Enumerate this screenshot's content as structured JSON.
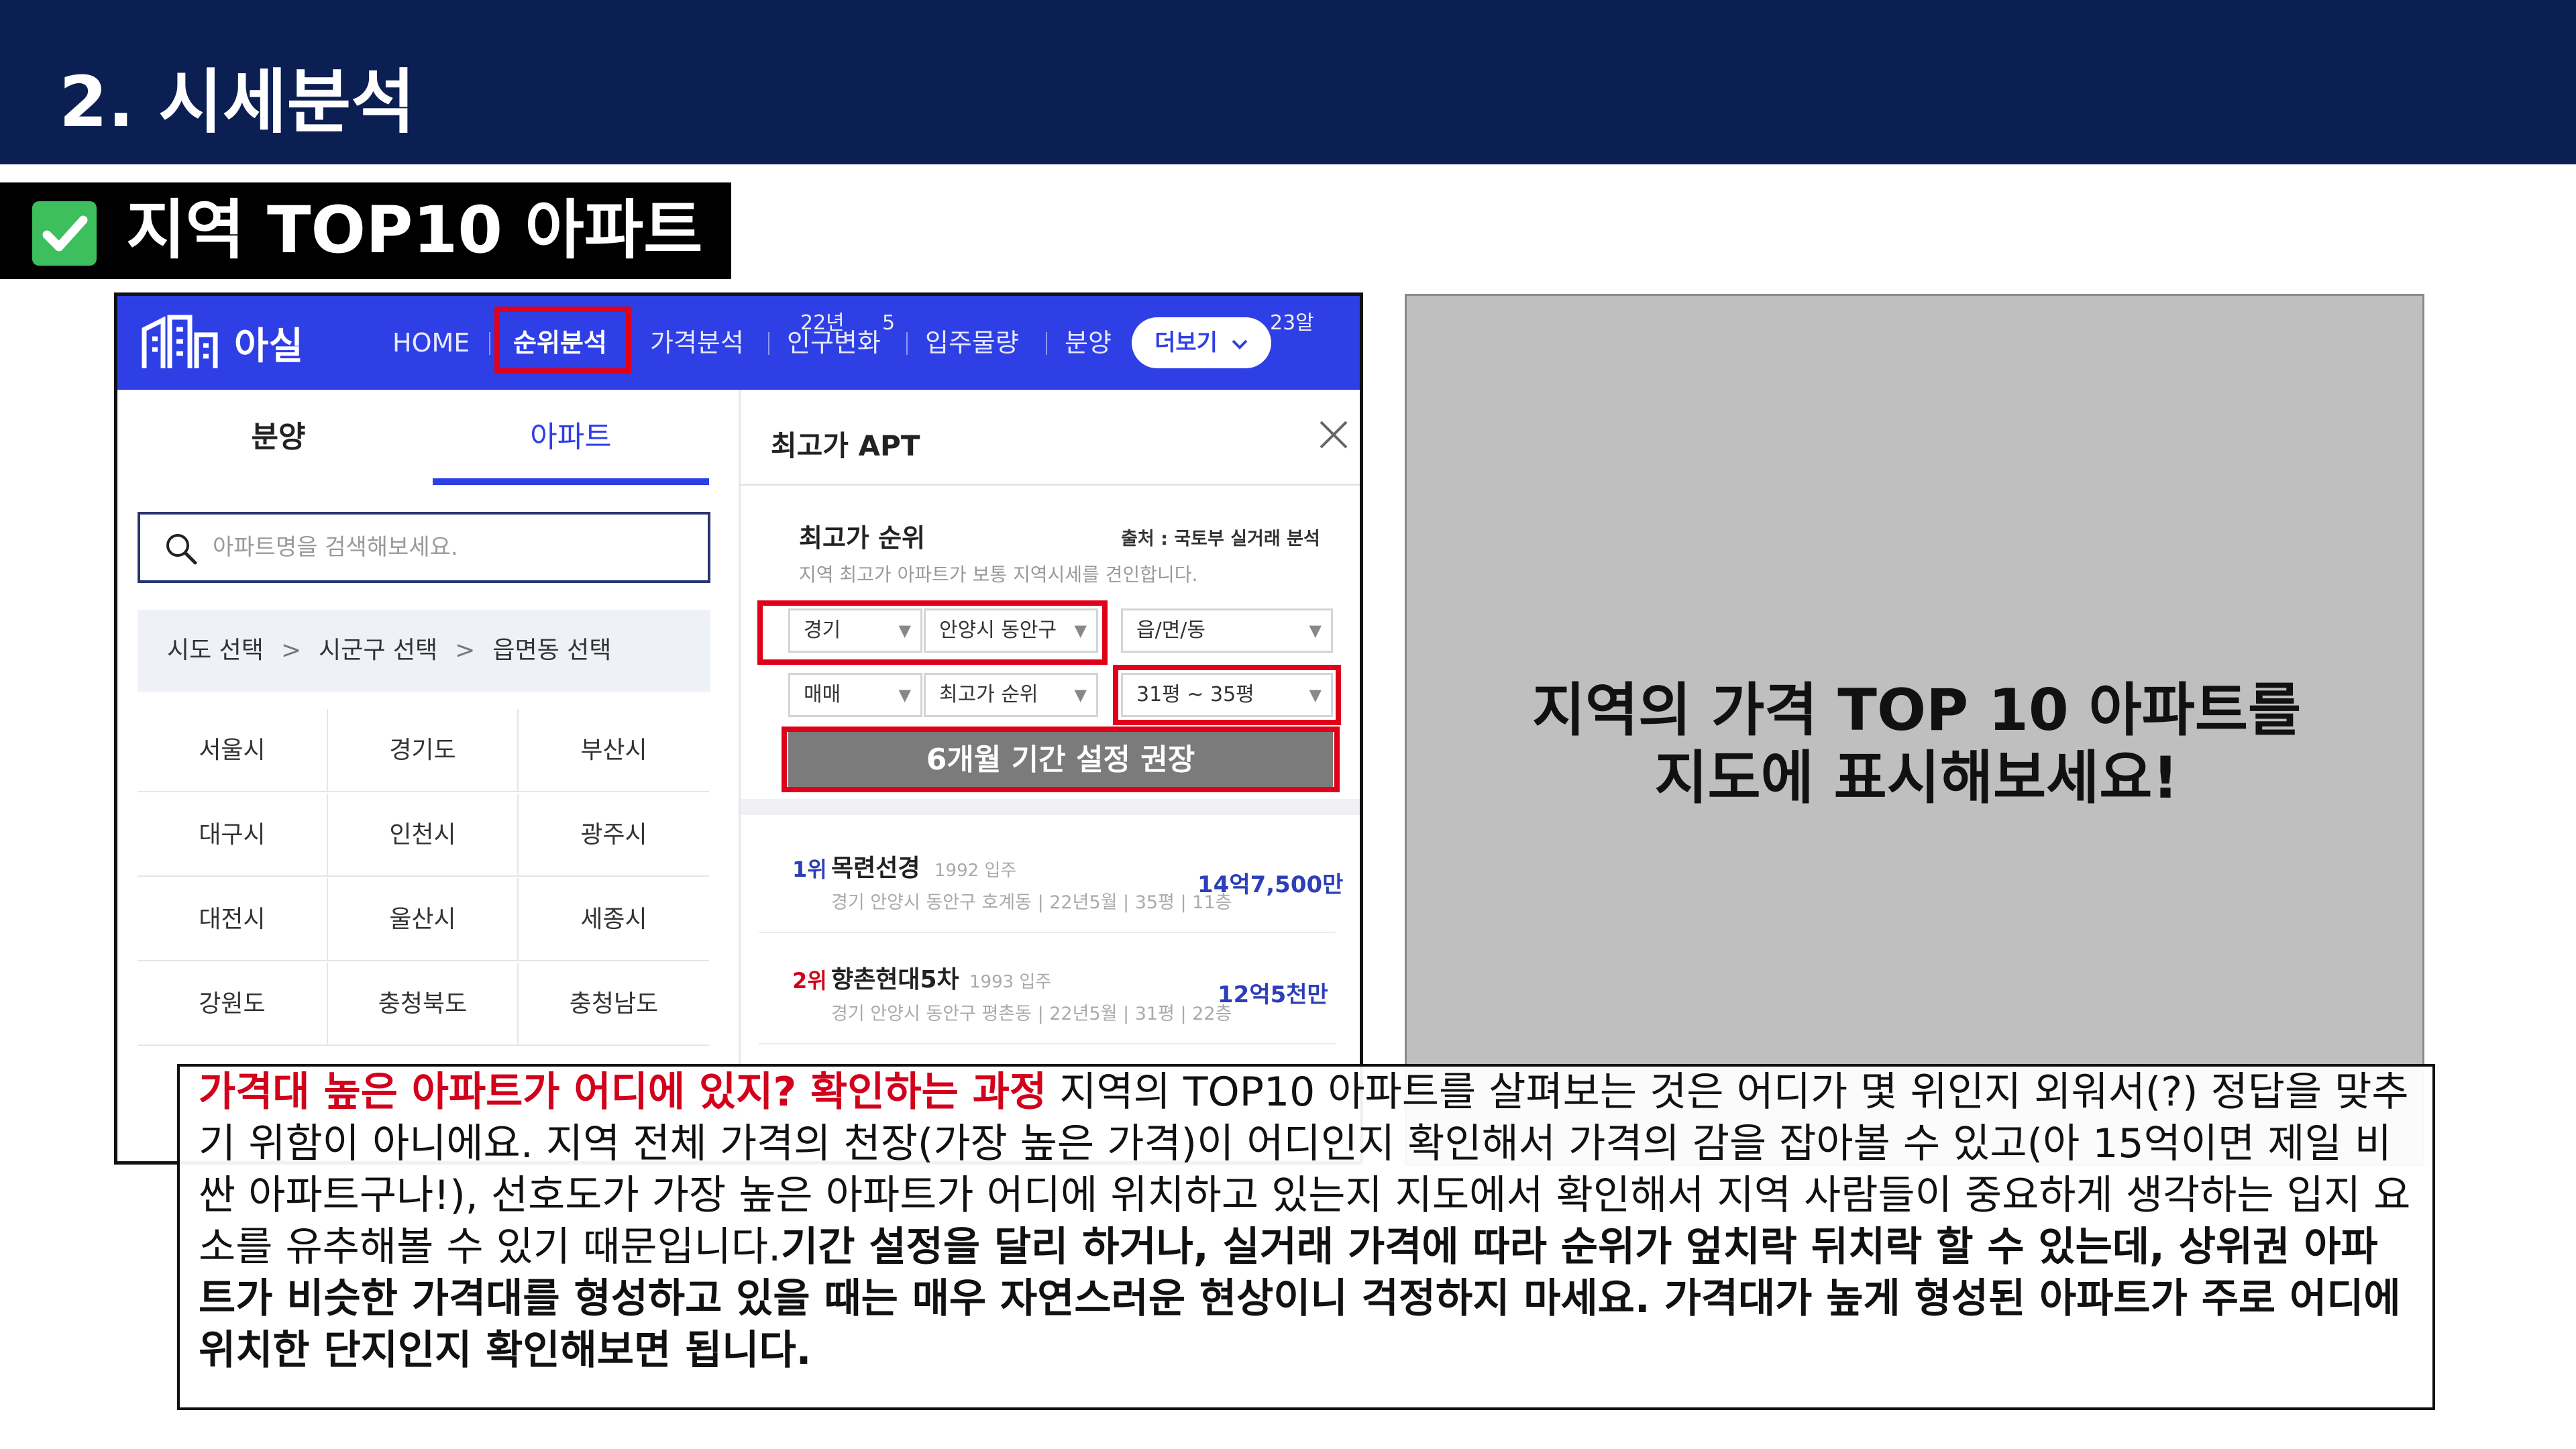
{
  "slide": {
    "title": "2. 시세분석",
    "subtitle": "지역 TOP10 아파트"
  },
  "app": {
    "logo_text": "아실",
    "nav": [
      "HOME",
      "순위분석",
      "가격분석",
      "인구변화",
      "입주물량",
      "분양"
    ],
    "more_button": "더보기",
    "tabs": [
      "분양",
      "아파트"
    ],
    "search_placeholder": "아파트명을 검색해보세요.",
    "region_path": [
      "시도 선택",
      "시군구 선택",
      "읍면동 선택"
    ],
    "regions": [
      "서울시",
      "경기도",
      "부산시",
      "대구시",
      "인천시",
      "광주시",
      "대전시",
      "울산시",
      "세종시",
      "강원도",
      "충청북도",
      "충청남도"
    ],
    "panel": {
      "title": "최고가 APT",
      "rank_title": "최고가 순위",
      "source": "출처 : 국토부 실거래 분석",
      "description": "지역 최고가 아파트가 보통 지역시세를 견인합니다.",
      "filters": {
        "province": "경기",
        "district": "안양시 동안구",
        "town": "읍/면/동",
        "deal_type": "매매",
        "sort": "최고가 순위",
        "size": "31평 ~ 35평"
      },
      "date": {
        "start": "22년",
        "month": "5",
        "end": "23알",
        "overlay": "6개월 기간 설정 권장"
      },
      "ranks": [
        {
          "rank": "1위",
          "name": "목련선경",
          "year": "1992 입주",
          "info": "경기 안양시 동안구 호계동 | 22년5월 | 35평 | 11층",
          "price": "14억7,500만"
        },
        {
          "rank": "2위",
          "name": "향촌현대5차",
          "year": "1993 입주",
          "info": "경기 안양시 동안구 평촌동 | 22년5월 | 31평 | 22층",
          "price": "12억5천만"
        }
      ]
    }
  },
  "placeholder": {
    "line1": "지역의 가격 TOP 10 아파트를",
    "line2": "지도에 표시해보세요!"
  },
  "description": {
    "heading": "가격대 높은 아파트가 어디에 있지? 확인하는 과정",
    "body": " 지역의 TOP10 아파트를 살펴보는 것은 어디가 몇 위인지 외워서(?) 정답을 맞추기 위함이 아니에요. 지역 전체 가격의 천장(가장 높은 가격)이 어디인지 확인해서 가격의 감을 잡아볼 수 있고(아 15억이면 제일 비싼 아파트구나!), 선호도가 가장 높은 아파트가 어디에 위치하고 있는지 지도에서 확인해서 지역 사람들이 중요하게 생각하는 입지 요소를 유추해볼 수 있기 때문입니다.",
    "bold": "기간 설정을 달리 하거나, 실거래 가격에 따라 순위가 엎치락 뒤치락 할 수 있는데, 상위권 아파트가 비슷한 가격대를 형성하고 있을 때는 매우 자연스러운 현상이니 걱정하지 마세요. 가격대가 높게 형성된 아파트가 주로 어디에 위치한 단지인지 확인해보면 됩니다."
  },
  "colors": {
    "header_navy": "#0b1f52",
    "nav_blue": "#2f3fe6",
    "highlight_red": "#e0001a",
    "check_green": "#3cbf5c",
    "placeholder_gray": "#bfbfbf"
  },
  "icons": [
    "check-icon",
    "building-logo-icon",
    "search-icon",
    "close-icon",
    "chevron-down-icon"
  ]
}
